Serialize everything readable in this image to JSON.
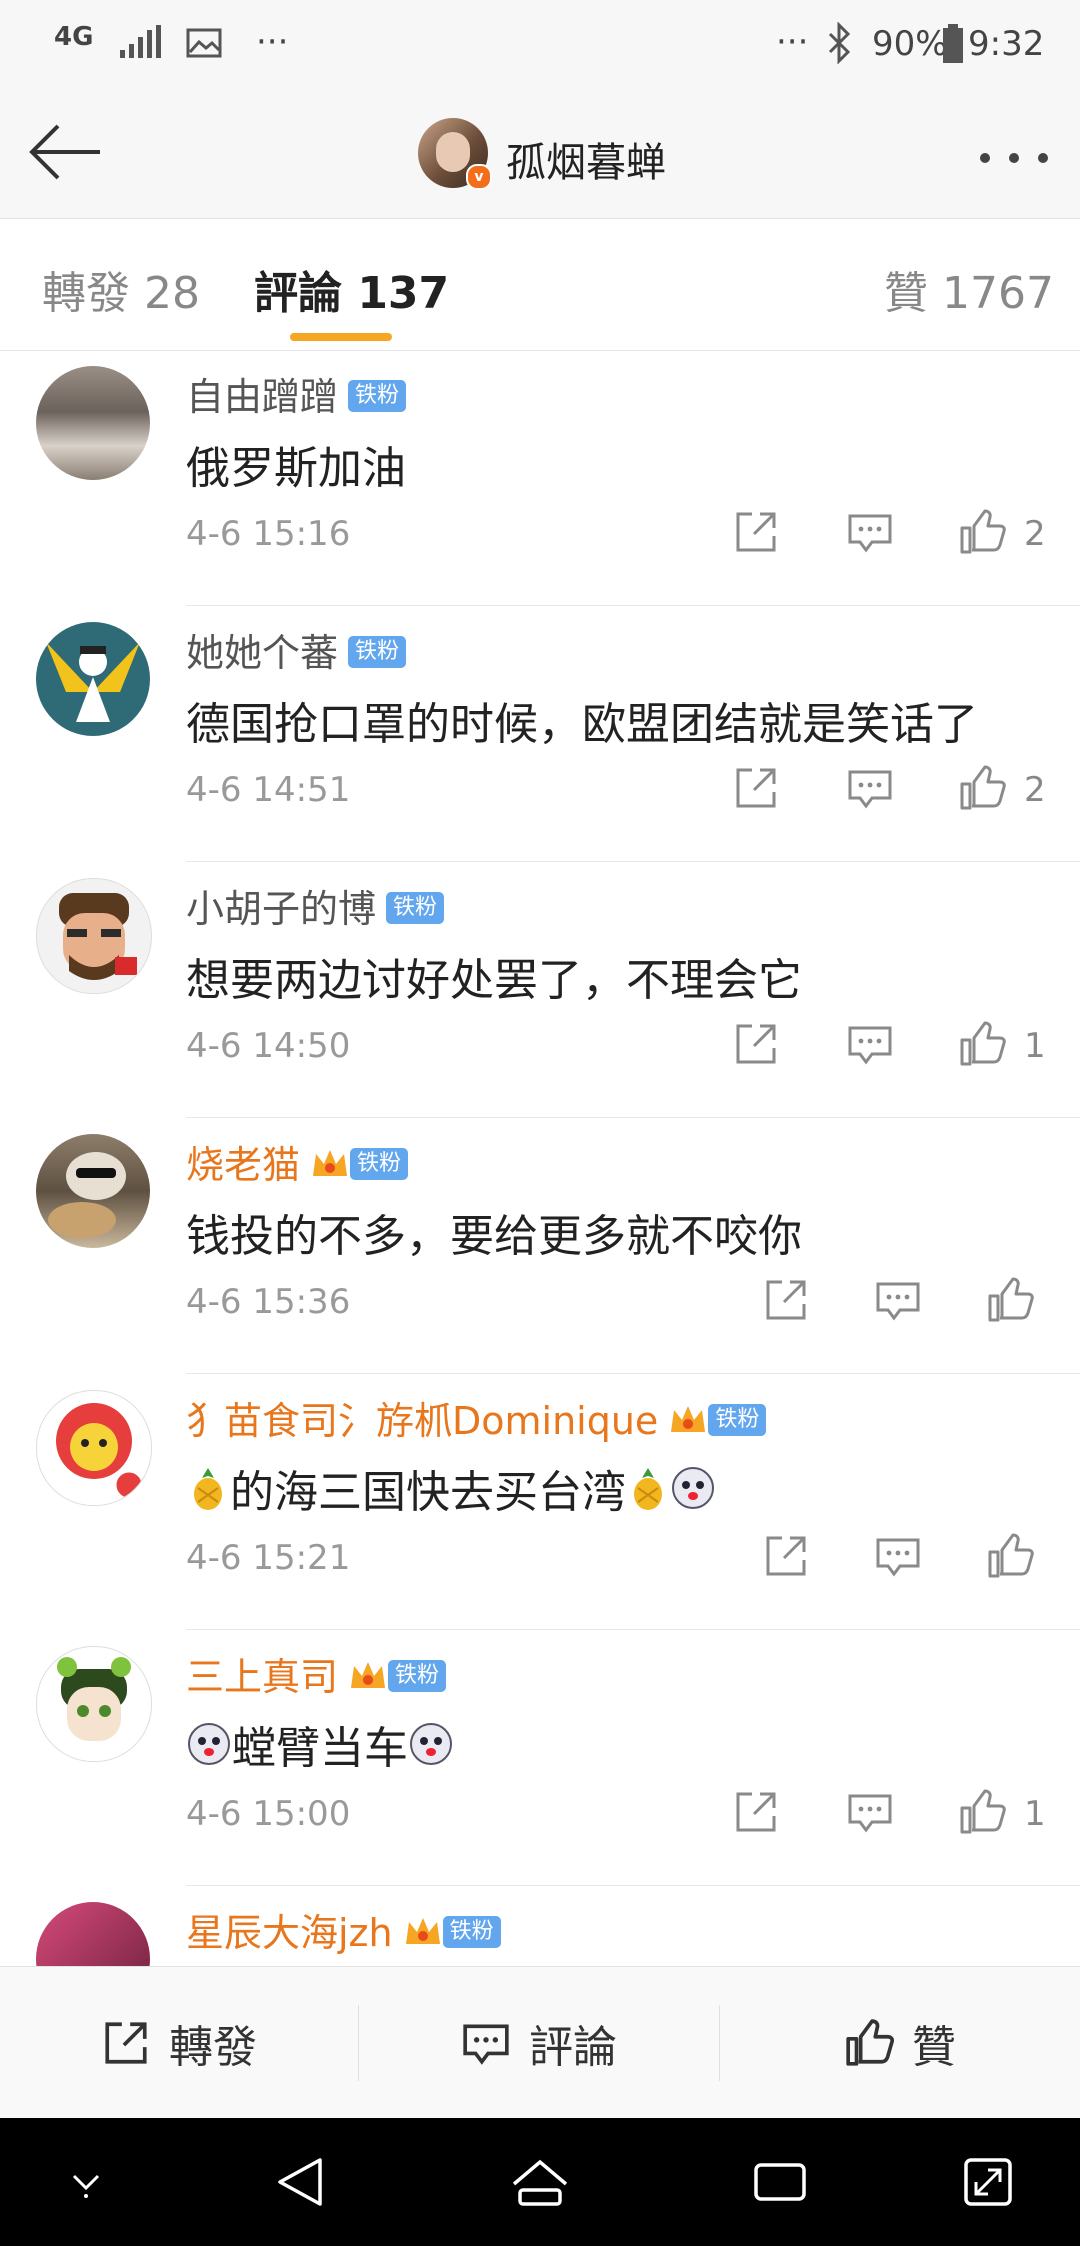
{
  "status_bar": {
    "network": "4G",
    "battery": "90%",
    "time": "9:32"
  },
  "header": {
    "title": "孤烟暮蝉"
  },
  "tabs": [
    {
      "label": "轉發 28"
    },
    {
      "label": "評論 137"
    },
    {
      "label": "贊 1767"
    }
  ],
  "comments": [
    {
      "username": "自由蹭蹭",
      "badge": "铁粉",
      "text": "俄罗斯加油",
      "time": "4-6 15:16",
      "likes": "2"
    },
    {
      "username": "她她个蕃",
      "badge": "铁粉",
      "text": "德国抢口罩的时候，欧盟团结就是笑话了",
      "time": "4-6 14:51",
      "likes": "2"
    },
    {
      "username": "小胡子的博",
      "badge": "铁粉",
      "text": "想要两边讨好处罢了，不理会它",
      "time": "4-6 14:50",
      "likes": "1"
    },
    {
      "username": "烧老猫",
      "badge": "铁粉",
      "text": "钱投的不多，要给更多就不咬你",
      "time": "4-6 15:36",
      "likes": ""
    },
    {
      "username": "犭苗食司氵斿枛Dominique",
      "badge": "铁粉",
      "text": "的海三国快去买台湾",
      "time": "4-6 15:21",
      "likes": ""
    },
    {
      "username": "三上真司",
      "badge": "铁粉",
      "text": "螳臂当车",
      "time": "4-6 15:00",
      "likes": "1"
    },
    {
      "username": "星辰大海jzh",
      "badge": "铁粉"
    }
  ],
  "bottom_bar": {
    "repost": "轉發",
    "comment": "評論",
    "like": "贊"
  },
  "colors": {
    "accent": "#f5a623",
    "vip_name": "#e8761c",
    "badge": "#62a6ee"
  }
}
